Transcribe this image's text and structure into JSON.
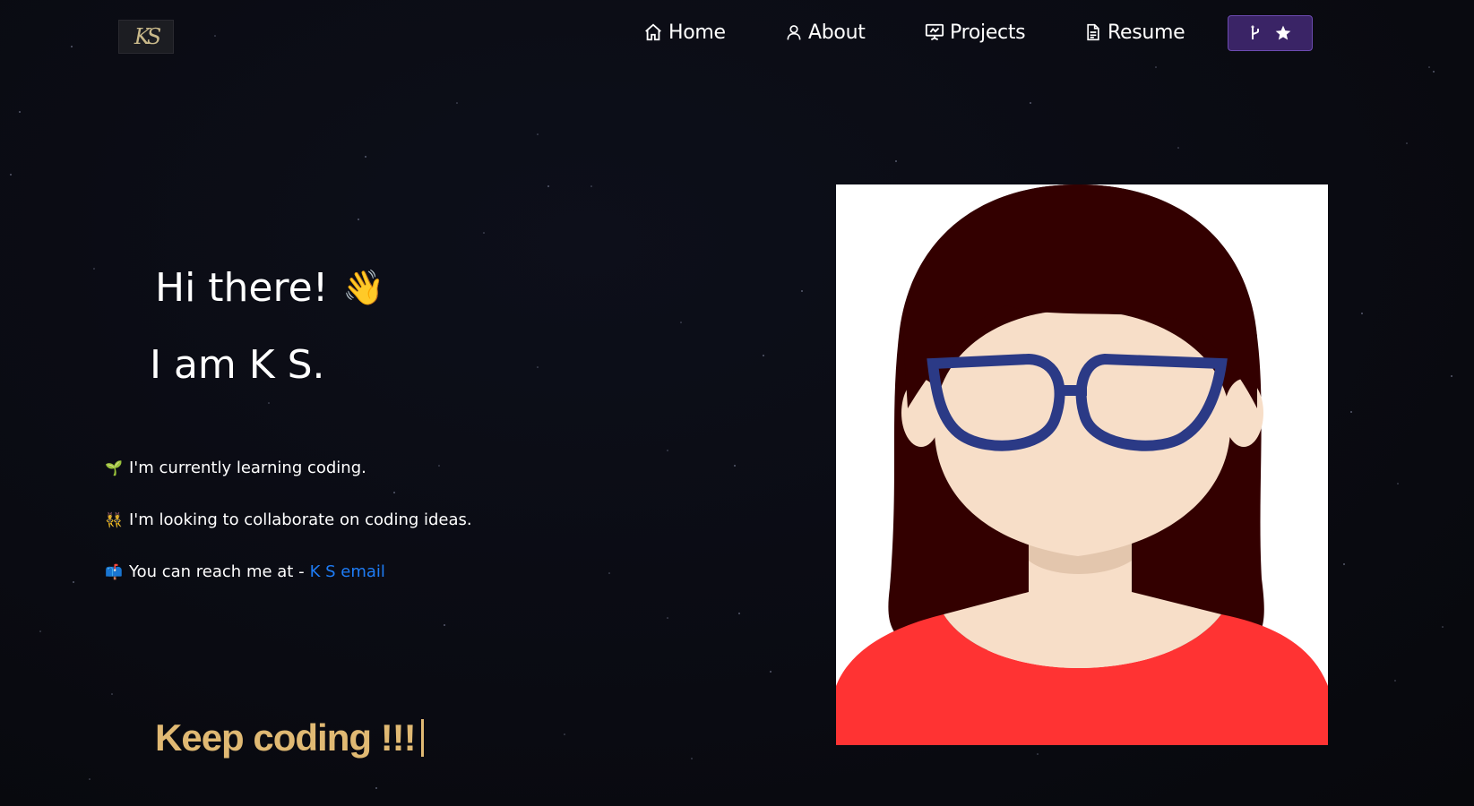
{
  "nav": {
    "logo_text": "KS",
    "items": [
      {
        "label": "Home",
        "icon": "home-icon"
      },
      {
        "label": "About",
        "icon": "user-icon"
      },
      {
        "label": "Projects",
        "icon": "presentation-icon"
      },
      {
        "label": "Resume",
        "icon": "document-icon"
      }
    ],
    "fork_button": {
      "icons": [
        "git-fork-icon",
        "star-icon"
      ],
      "color": "#3a2466"
    }
  },
  "hero": {
    "greeting": "Hi there!",
    "wave_emoji": "👋",
    "intro": "I am K S.",
    "bullets": [
      {
        "emoji": "🌱",
        "text": "I'm currently learning coding."
      },
      {
        "emoji": "👯",
        "text": "I'm looking to collaborate on coding ideas."
      },
      {
        "emoji": "📫",
        "text": "You can reach me at -",
        "link": "K S email"
      }
    ],
    "tagline": "Keep coding !!!"
  },
  "colors": {
    "background": "#0a0b12",
    "link": "#1e7cf5",
    "tagline": "#e0b973",
    "fork_button": "#3a2466"
  }
}
